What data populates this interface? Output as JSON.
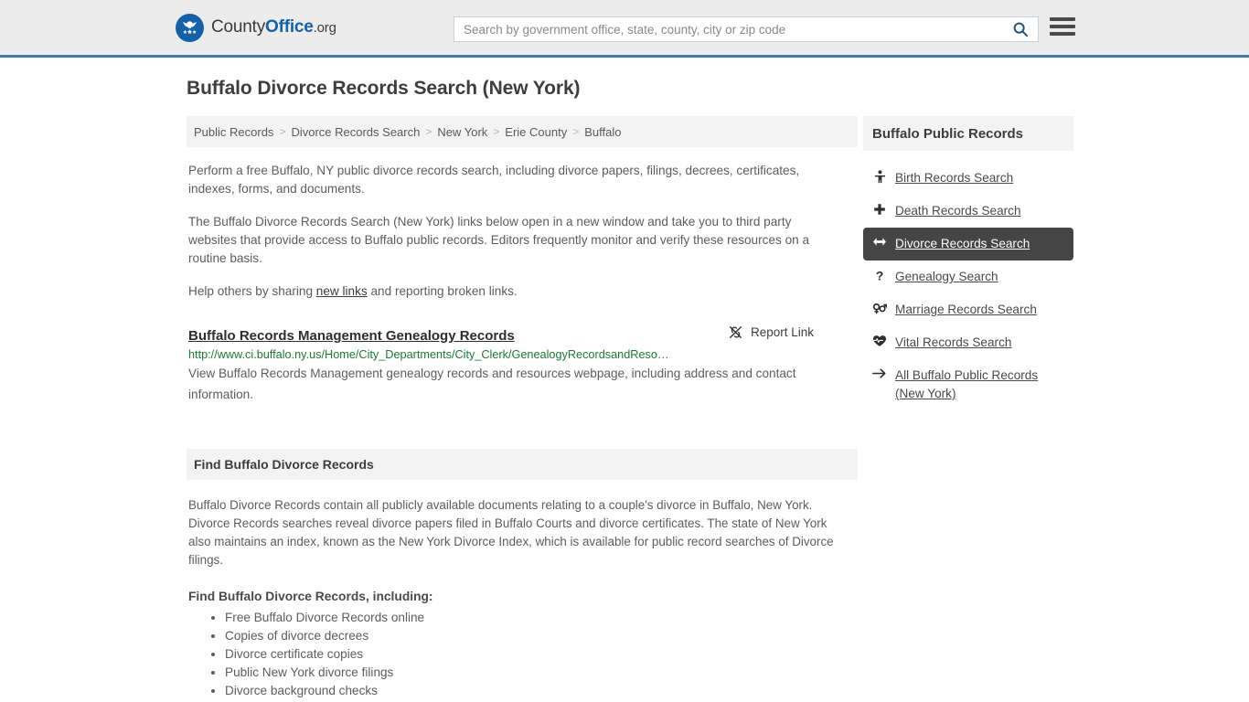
{
  "header": {
    "logo": {
      "icon": "eagle-stars-seal-icon",
      "part1": "County",
      "part2": "Office",
      "part3": ".org"
    },
    "search": {
      "placeholder": "Search by government office, state, county, city or zip code",
      "value": "",
      "icon": "search-icon"
    },
    "menu_icon": "hamburger-menu-icon"
  },
  "page": {
    "title": "Buffalo Divorce Records Search (New York)"
  },
  "breadcrumb": {
    "separator": ">",
    "items": [
      {
        "label": "Public Records"
      },
      {
        "label": "Divorce Records Search"
      },
      {
        "label": "New York"
      },
      {
        "label": "Erie County"
      },
      {
        "label": "Buffalo"
      }
    ]
  },
  "intro": {
    "p1": "Perform a free Buffalo, NY public divorce records search, including divorce papers, filings, decrees, certificates, indexes, forms, and documents.",
    "p2": "The Buffalo Divorce Records Search (New York) links below open in a new window and take you to third party websites that provide access to Buffalo public records. Editors frequently monitor and verify these resources on a routine basis.",
    "p3_before": "Help others by sharing ",
    "p3_link": "new links",
    "p3_after": " and reporting broken links."
  },
  "result": {
    "title": "Buffalo Records Management Genealogy Records",
    "report_label": "Report Link",
    "report_icon": "broken-link-icon",
    "url": "http://www.ci.buffalo.ny.us/Home/City_Departments/City_Clerk/GenealogyRecordsandReso…",
    "description": "View Buffalo Records Management genealogy records and resources webpage, including address and contact information."
  },
  "section": {
    "heading": "Find Buffalo Divorce Records",
    "body": "Buffalo Divorce Records contain all publicly available documents relating to a couple's divorce in Buffalo, New York. Divorce Records searches reveal divorce papers filed in Buffalo Courts and divorce certificates. The state of New York also maintains an index, known as the New York Divorce Index, which is available for public record searches of Divorce filings.",
    "list_title": "Find Buffalo Divorce Records, including:",
    "bullets": [
      "Free Buffalo Divorce Records online",
      "Copies of divorce decrees",
      "Divorce certificate copies",
      "Public New York divorce filings",
      "Divorce background checks"
    ]
  },
  "sidebar": {
    "heading": "Buffalo Public Records",
    "items": [
      {
        "label": "Birth Records Search",
        "icon": "baby-icon",
        "active": false
      },
      {
        "label": "Death Records Search",
        "icon": "cross-icon",
        "active": false
      },
      {
        "label": "Divorce Records Search",
        "icon": "arrows-left-right-icon",
        "active": true
      },
      {
        "label": "Genealogy Search",
        "icon": "question-mark-icon",
        "active": false
      },
      {
        "label": "Marriage Records Search",
        "icon": "venus-mars-icon",
        "active": false
      },
      {
        "label": "Vital Records Search",
        "icon": "heartbeat-icon",
        "active": false
      },
      {
        "label": "All Buffalo Public Records (New York)",
        "icon": "arrow-right-icon",
        "active": false
      }
    ]
  },
  "colors": {
    "header_bg": "#ececec",
    "header_border": "#3a7ab0",
    "brand_blue": "#1461a8",
    "url_green": "#1c7b34",
    "active_item_bg": "#454545",
    "panel_bg": "#f3f3f3"
  }
}
